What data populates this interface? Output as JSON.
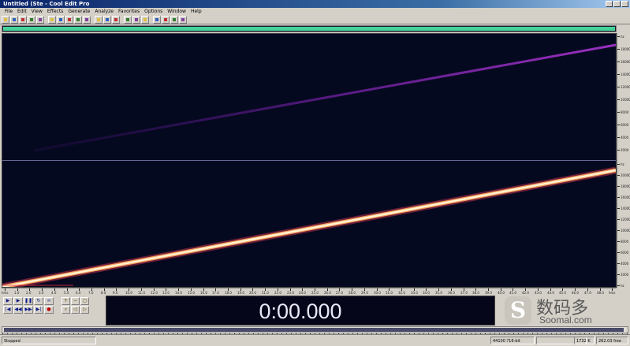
{
  "window": {
    "title": "Untitled (Ste - Cool Edit Pro"
  },
  "menu": [
    "File",
    "Edit",
    "View",
    "Effects",
    "Generate",
    "Analyze",
    "Favorites",
    "Options",
    "Window",
    "Help"
  ],
  "toolbar": {
    "icons": [
      "new-icon",
      "open-icon",
      "save-icon",
      "save-all-icon",
      "close-icon",
      "cut-icon",
      "copy-icon",
      "paste-icon",
      "paste-new-icon",
      "mix-paste-icon",
      "undo-icon",
      "redo-icon",
      "repeat-icon",
      "waveform-view-icon",
      "spectral-view-icon",
      "multitrack-icon",
      "cd-icon",
      "properties-icon",
      "settings-icon",
      "help-icon"
    ],
    "accent_colors": [
      "#e0c040",
      "#3060c0",
      "#c03030",
      "#308030",
      "#8040a0"
    ]
  },
  "colors": {
    "overview": "#45d39a",
    "spectrogram_bg": "#05091f",
    "upper_sweep": "#8a2ab0",
    "lower_sweep": "#ffe8b0",
    "lower_sweep_edge": "#e0404a"
  },
  "vertical_ruler": {
    "upper_labels": [
      "hz",
      "18000",
      "16000",
      "14000",
      "12000",
      "10000",
      "8000",
      "6000",
      "4000",
      "2000"
    ],
    "lower_labels": [
      "hz",
      "20000",
      "18000",
      "16000",
      "14000",
      "12000",
      "10000",
      "8000",
      "6000",
      "4000",
      "2000",
      "hz"
    ]
  },
  "horizontal_ruler": {
    "labels": [
      "hms",
      "1.0",
      "2.0",
      "3.0",
      "4.0",
      "5.0",
      "6.0",
      "7.0",
      "8.0",
      "9.0",
      "10.0",
      "11.0",
      "12.0",
      "13.0",
      "14.0",
      "15.0",
      "16.0",
      "17.0",
      "18.0",
      "19.0",
      "20.0",
      "21.0",
      "22.0",
      "23.0",
      "24.0",
      "25.0",
      "26.0",
      "27.0",
      "28.0",
      "29.0",
      "30.0",
      "31.0",
      "32.0",
      "33.0",
      "34.0",
      "35.0",
      "36.0",
      "37.0",
      "38.0",
      "39.0",
      "40.0",
      "41.0",
      "42.0",
      "43.0",
      "44.0",
      "45.0",
      "46.0",
      "47.0",
      "48.0",
      "hms"
    ]
  },
  "transport": {
    "row1": [
      "play-icon",
      "play-from-cursor-icon",
      "pause-icon",
      "loop-icon",
      "loop-toggle-icon"
    ],
    "row2": [
      "go-start-icon",
      "rewind-icon",
      "fast-forward-icon",
      "go-end-icon",
      "record-icon"
    ]
  },
  "zoom": {
    "row1": [
      "zoom-in-icon",
      "zoom-out-icon",
      "zoom-full-icon"
    ],
    "row2": [
      "zoom-selection-icon",
      "zoom-left-icon",
      "zoom-right-icon"
    ]
  },
  "time_display": "0:00.000",
  "watermark": {
    "logo_glyph": "S",
    "cn": "数码多",
    "en": "Soomal.com"
  },
  "status": {
    "state": "Stopped",
    "format": "44100 ?16-bit Stereo",
    "size": "1732 K",
    "free": "262.03 free"
  }
}
